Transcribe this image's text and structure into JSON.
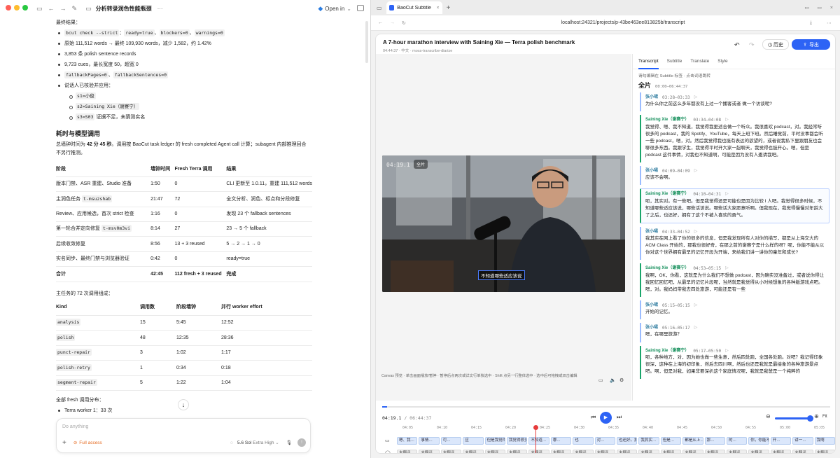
{
  "left": {
    "title": "分析转录润色性能瓶颈",
    "more": "···",
    "open_in": "Open in",
    "final_result_label": "最终结果：",
    "bullets": [
      {
        "parts": [
          {
            "code": "bcut check --strict"
          },
          {
            "text": "："
          },
          {
            "code": "ready=true"
          },
          {
            "text": "、"
          },
          {
            "code": "blockers=0"
          },
          {
            "text": "、"
          },
          {
            "code": "warnings=0"
          }
        ]
      },
      {
        "parts": [
          {
            "text": "原始 111,512 words → 最终 109,930 words，减少 1,582，约 1.42%"
          }
        ]
      },
      {
        "parts": [
          {
            "text": "3,853 条 polish sentence records"
          }
        ]
      },
      {
        "parts": [
          {
            "text": "9,723 cues，最长宽度 50，超宽 0"
          }
        ]
      },
      {
        "parts": [
          {
            "code": "fallbackPages=0"
          },
          {
            "text": "、"
          },
          {
            "code": "fallbackSentences=0"
          }
        ]
      },
      {
        "parts": [
          {
            "text": "说话人已核验并应用："
          }
        ]
      }
    ],
    "speakers": [
      {
        "parts": [
          {
            "code": "s1=小俊"
          }
        ]
      },
      {
        "parts": [
          {
            "code": "s2=Saining Xie（谢赛宁）"
          }
        ]
      },
      {
        "parts": [
          {
            "code": "s3=S03"
          },
          {
            "text": " 证据不足，未猜测实名"
          }
        ]
      }
    ],
    "section_title": "耗时与模型调用",
    "section_p1": "总墙钟时间为 ",
    "section_bold": "42 分 45 秒",
    "section_p2": "。调用按 BaoCut task ledger 的 fresh completed Agent call 计算；subagent 内部推理回合",
    "section_p3": "不另行推测。",
    "table1": {
      "headers": [
        "阶段",
        "墙钟时间",
        "Fresh Terra 调用",
        "结果"
      ],
      "rows": [
        [
          {
            "t": "版本门禁、ASR 重建、Studio 准备"
          },
          {
            "t": "1:50"
          },
          {
            "t": "0"
          },
          {
            "t": "CLI 更新至 1.0.11，重建 111,512 words"
          }
        ],
        [
          {
            "t": "主润色任务 ",
            "c": "t-msuzshab"
          },
          {
            "t": "21:47"
          },
          {
            "t": "72"
          },
          {
            "t": "全文分析、润色、标点和分段修复"
          }
        ],
        [
          {
            "t": "Review、应用候选，首次 strict 检查"
          },
          {
            "t": "1:16"
          },
          {
            "t": "0"
          },
          {
            "t": "发现 23 个 fallback sentences"
          }
        ],
        [
          {
            "t": "第一轮合并定向修复 ",
            "c": "t-msv0m3vi"
          },
          {
            "t": "8:14"
          },
          {
            "t": "27"
          },
          {
            "t": "23 → 5 个 fallback"
          }
        ],
        [
          {
            "t": "后续收敛修复"
          },
          {
            "t": "8:56"
          },
          {
            "t": "13 + 3 reused"
          },
          {
            "t": "5 → 2 → 1 → 0"
          }
        ],
        [
          {
            "t": "实名同步、最终门禁与浏览器验证"
          },
          {
            "t": "0:42"
          },
          {
            "t": "0"
          },
          {
            "t": "ready=true"
          }
        ]
      ],
      "total": [
        "合计",
        "42:45",
        "112 fresh + 3 reused",
        "完成"
      ]
    },
    "table2_intro": "主任务的 72 次调用组成：",
    "table2": {
      "headers": [
        "Kind",
        "调用数",
        "阶段墙钟",
        "并行 worker effort"
      ],
      "rows": [
        [
          "analysis",
          "15",
          "5:45",
          "12:52"
        ],
        [
          "polish",
          "48",
          "12:35",
          "28:36"
        ],
        [
          "punct-repair",
          "3",
          "1:02",
          "1:17"
        ],
        [
          "polish-retry",
          "1",
          "0:34",
          "0:18"
        ],
        [
          "segment-repair",
          "5",
          "1:22",
          "1:04"
        ]
      ]
    },
    "dist_intro": "全部 fresh 调用分布：",
    "dist": [
      "Terra worker 1：33 次",
      "Terra worker 2：37 次",
      "Terra worker 3：42 次"
    ],
    "composer": {
      "placeholder": "Do anything",
      "access": "Full access",
      "model": "5.6 Sol",
      "effort": "Extra High"
    }
  },
  "browser": {
    "tab_title": "BaoCut Subtitle",
    "url": "localhost:24321/projects/p-43be463ee813825b/transcript"
  },
  "page": {
    "title": "A 7-hour marathon interview with Saining Xie — Terra polish benchmark",
    "meta": "04:44:37 · 中文 · moss-transcribe-diarize",
    "history": "历史",
    "export": "导出",
    "video_timecode": "04:19.1",
    "video_badge": "全片",
    "video_caption": "不知道哪些适应该说",
    "hint": "Canvas 预览 · 单击画面播放/暂停 · 暂停后点两次或详文行单独选中 · Shift 点另一行整体选中 · 选中后可拖拽或双击编辑",
    "time_current": "04:19.1",
    "time_total": "/ 06:44:37",
    "fit": "Fit",
    "tabs": [
      "Transcript",
      "Subtitle",
      "Translate",
      "Style"
    ],
    "side_hint": "请勾编辑在 Subtitle 标签 · 点击词语跳转",
    "section_label": "全片",
    "section_time": "00:00–06:44:37",
    "segments": [
      {
        "speaker": "张小珺",
        "time": "03:28–03:33",
        "text": "为什么你之前这么多年都没有上过一个播客或者 做一个访谈呢?",
        "s2": false,
        "hl": false
      },
      {
        "speaker": "Saining Xie（谢赛宁）",
        "time": "03:34–04:08",
        "text": "我觉得、嗯、我不知道，我觉得我更适合做一个听众。我很喜欢 podcast，对。我经常听很多的 podcast，我的 Spotify、YouTube，每天上班下班。然后睡觉前，平时没事都会听一些 podcast，嗯，对。然后我觉得我也挺有表达的欲望的，或者说我私下里跟朋友也会聊很多东西。我跟学生，我觉得平时开大家一起聊天，我觉得也挺开心。嗯，但是 podcast 这件事情，对我也不知道啊，可能是因为没有人邀请我吧。",
        "s2": true,
        "hl": false
      },
      {
        "speaker": "张小珺",
        "time": "04:09–04:09",
        "text": "应该不会啊。",
        "s2": false,
        "hl": false
      },
      {
        "speaker": "Saining Xie（谢赛宁）",
        "time": "04:10–04:31",
        "text": "呃，其实对。有一些吧。但是我觉得还是可能也是因为比较 I 人吧。我觉得很多时候，不知道哪些适应该说，哪些话该说。哪些话大家愿意听啊。但我现在，我觉得慢慢对年龄大了之后，也还好，拥有了这个不被人喜欢的勇气。",
        "s2": true,
        "hl": true
      },
      {
        "speaker": "张小珺",
        "time": "04:33–04:52",
        "text": "我其实在网上看了你的很多的信息，但是我发现所有人对你的描写，都是从上海交大的 ACM Class 开始的，那我也很好奇，在那之前的谢赛宁是什么样的呀？呢，你能不能从以你对这个世界拥有最早的记忆开段为开端，来给我们讲一讲你的童年和成长?",
        "s2": false,
        "hl": false
      },
      {
        "speaker": "Saining Xie（谢赛宁）",
        "time": "04:53–05:15",
        "text": "我啊，OK，你看，这就是为什么我们不想做 podcast，因为确实没准备过，或者说你得让我回忆回忆吧，从最早的记忆片段呢，当然就是我觉得从小时候想象的各种版游戏点吧。嗯，对。我妈妈带我去四处旅游，可能还是有一些",
        "s2": true,
        "hl": false
      },
      {
        "speaker": "张小珺",
        "time": "05:15–05:15",
        "text": "开始的记忆。",
        "s2": false,
        "hl": false
      },
      {
        "speaker": "张小珺",
        "time": "05:16–05:17",
        "text": "嗯，在哪里旅游？",
        "s2": false,
        "hl": false
      },
      {
        "speaker": "Saining Xie（谢赛宁）",
        "time": "05:17–05:50",
        "text": "呃，各种地方，对，因为她也做一些生意，然后四处跑，全国各处跑。对吧？我记得印象很深，这种在上海的初印象，然后去四川啊，然后也还是我就是最接象的各种旅游景点吧。啊，但是对我，如果非要深扒这个家庭情况呢，我就是我爸是一个纯粹的",
        "s2": true,
        "hl": false
      }
    ],
    "ruler": [
      "04:05",
      "04:10",
      "04:15",
      "04:20",
      "04:25",
      "04:30",
      "04:35",
      "04:40",
      "04:45",
      "04:50",
      "04:55",
      "05:00",
      "05:05"
    ],
    "track1_clips": [
      "嗯、我…",
      "事情…",
      "可…",
      "应",
      "但是我觉得…",
      "我觉得很多时候…",
      "不知道…",
      "哪…",
      "也",
      "对…",
      "也还好。拥有…",
      "我其实…",
      "但是…",
      "都是从上…",
      "那…",
      "的…",
      "你，你能不能从以…",
      "开…",
      "讲一…",
      "我啊"
    ],
    "track2_clips": [
      "未翻译",
      "未翻译",
      "未翻译",
      "未翻译",
      "未翻译",
      "未翻译",
      "未翻译",
      "未翻译",
      "未翻译",
      "未翻译",
      "未翻译",
      "未翻译",
      "未翻译",
      "未翻译",
      "未翻译",
      "未翻译",
      "未翻译",
      "未翻译",
      "未翻译",
      "未翻译"
    ],
    "colors": {
      "accent": "#2d63f5",
      "speaker": "#16905c",
      "playhead": "#e63b3b"
    }
  }
}
